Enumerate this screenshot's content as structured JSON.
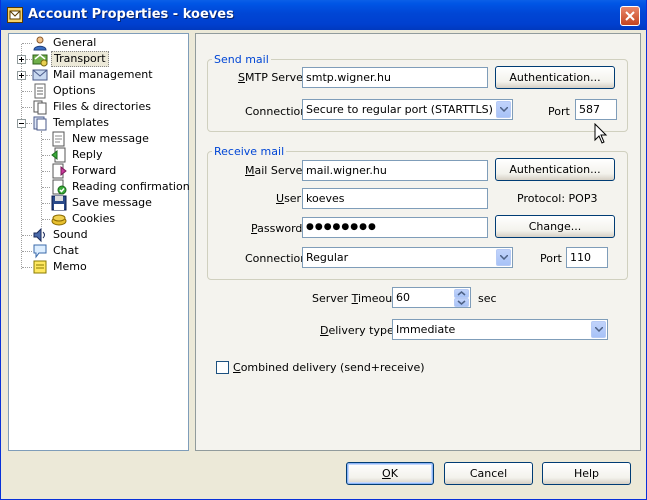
{
  "window": {
    "title": "Account Properties - koeves"
  },
  "tree": {
    "items": [
      {
        "label": "General"
      },
      {
        "label": "Transport"
      },
      {
        "label": "Mail management"
      },
      {
        "label": "Options"
      },
      {
        "label": "Files & directories"
      },
      {
        "label": "Templates"
      },
      {
        "label": "New message"
      },
      {
        "label": "Reply"
      },
      {
        "label": "Forward"
      },
      {
        "label": "Reading confirmation"
      },
      {
        "label": "Save message"
      },
      {
        "label": "Cookies"
      },
      {
        "label": "Sound"
      },
      {
        "label": "Chat"
      },
      {
        "label": "Memo"
      }
    ],
    "selected": "Transport"
  },
  "send_mail": {
    "title": "Send mail",
    "smtp_label_underlined": "S",
    "smtp_label_rest": "MTP Server",
    "smtp_value": "smtp.wigner.hu",
    "auth_button": "Authentication...",
    "connection_label": "Connection",
    "connection_value": "Secure to regular port (STARTTLS)",
    "port_label": "Port",
    "port_value": "587"
  },
  "receive_mail": {
    "title": "Receive mail",
    "server_label_underlined": "M",
    "server_label_rest": "ail Server",
    "server_value": "mail.wigner.hu",
    "auth_button": "Authentication...",
    "user_label_underlined": "U",
    "user_label_rest": "ser",
    "user_value": "koeves",
    "protocol_text": "Protocol:  POP3",
    "password_label_underlined": "P",
    "password_label_rest": "assword",
    "password_value": "●●●●●●●●",
    "change_button": "Change...",
    "connection_label": "Connection",
    "connection_value": "Regular",
    "port_label": "Port",
    "port_value": "110"
  },
  "server_timeout": {
    "label_pre": "Server ",
    "label_underlined": "T",
    "label_post": "imeout",
    "value": "60",
    "unit": "sec"
  },
  "delivery": {
    "label_underlined": "D",
    "label_rest": "elivery type",
    "value": "Immediate"
  },
  "combined": {
    "label_underlined": "C",
    "label_rest": "ombined delivery (send+receive)",
    "checked": false
  },
  "footer": {
    "ok_underlined": "O",
    "ok_rest": "K",
    "cancel": "Cancel",
    "help": "Help"
  }
}
